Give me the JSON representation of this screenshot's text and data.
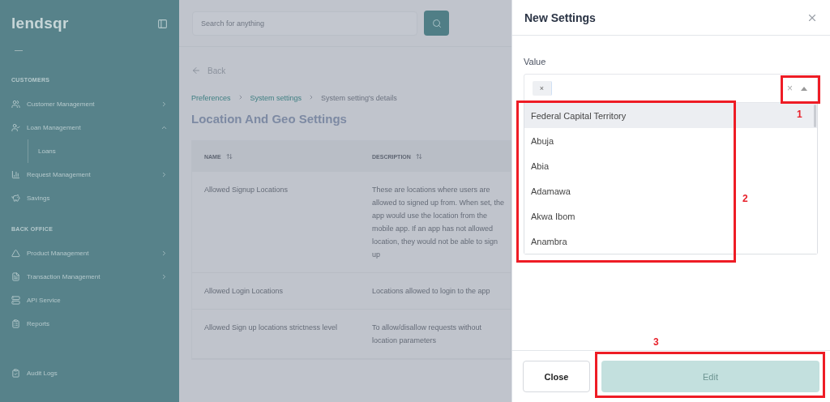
{
  "sidebar": {
    "logo": "lendsqr",
    "sections": [
      {
        "title": "CUSTOMERS",
        "items": [
          {
            "label": "Customer Management",
            "expanded": false
          },
          {
            "label": "Loan Management",
            "expanded": true,
            "children": [
              {
                "label": "Loans"
              }
            ]
          },
          {
            "label": "Request Management",
            "expanded": false
          },
          {
            "label": "Savings"
          }
        ]
      },
      {
        "title": "BACK OFFICE",
        "items": [
          {
            "label": "Product Management",
            "expanded": false
          },
          {
            "label": "Transaction Management",
            "expanded": false
          },
          {
            "label": "API Service"
          },
          {
            "label": "Reports"
          }
        ]
      }
    ],
    "footer_item": {
      "label": "Audit Logs"
    }
  },
  "main": {
    "search": {
      "placeholder": "Search for anything"
    },
    "back": "Back",
    "breadcrumbs": [
      {
        "label": "Preferences",
        "link": true
      },
      {
        "label": "System settings",
        "link": true
      },
      {
        "label": "System setting's details",
        "link": false
      }
    ],
    "title": "Location And Geo Settings",
    "table": {
      "columns": [
        "NAME",
        "DESCRIPTION"
      ],
      "rows": [
        [
          "Allowed Signup Locations",
          "These are locations where users are allowed to signed up from. When set, the app would use the location from the mobile app. If an app has not allowed location, they would not be able to sign up"
        ],
        [
          "Allowed Login Locations",
          "Locations allowed to login to the app"
        ],
        [
          "Allowed Sign up locations strictness level",
          "To allow/disallow requests without location parameters"
        ]
      ]
    }
  },
  "modal": {
    "title": "New Settings",
    "field_label": "Value",
    "tag_remove": "×",
    "clear": "×",
    "options": [
      {
        "label": "Federal Capital Territory",
        "selected": true
      },
      {
        "label": "Abuja",
        "selected": false
      },
      {
        "label": "Abia",
        "selected": false
      },
      {
        "label": "Adamawa",
        "selected": false
      },
      {
        "label": "Akwa Ibom",
        "selected": false
      },
      {
        "label": "Anambra",
        "selected": false
      }
    ],
    "buttons": [
      {
        "label": "Close",
        "kind": "secondary",
        "disabled": false
      },
      {
        "label": "Edit",
        "kind": "primary",
        "disabled": true
      }
    ]
  },
  "annotations": [
    "1",
    "2",
    "3"
  ]
}
